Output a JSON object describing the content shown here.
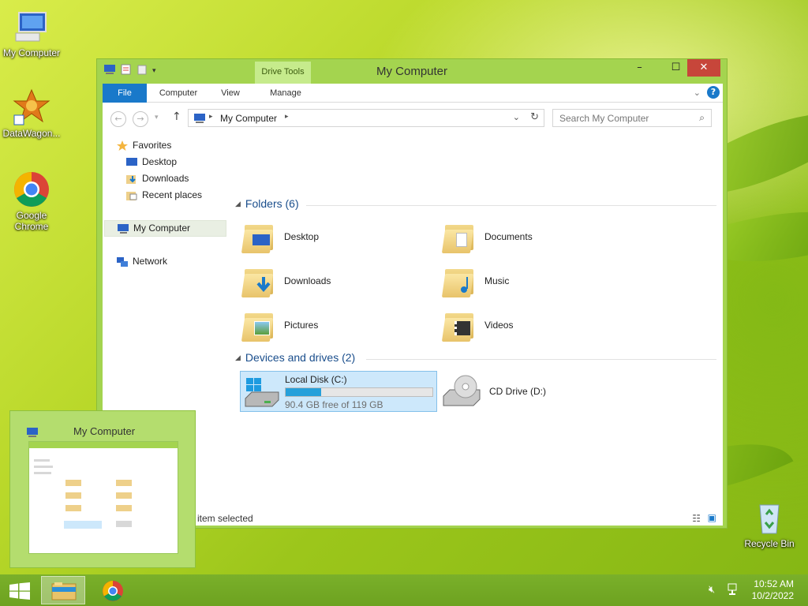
{
  "desktop": {
    "icons": [
      {
        "label": "My Computer"
      },
      {
        "label": "DataWagon..."
      },
      {
        "label": "Google Chrome"
      },
      {
        "label": "Recycle Bin"
      }
    ]
  },
  "window": {
    "title": "My Computer",
    "contextual_tab": "Drive Tools",
    "controls": {
      "minimize": "–",
      "maximize": "☐",
      "close": "✕"
    }
  },
  "ribbon": {
    "tabs": [
      {
        "label": "File"
      },
      {
        "label": "Computer"
      },
      {
        "label": "View"
      },
      {
        "label": "Manage"
      }
    ]
  },
  "address": {
    "path": "My Computer",
    "search_placeholder": "Search My Computer"
  },
  "nav_pane": {
    "favorites": "Favorites",
    "favorite_items": [
      "Desktop",
      "Downloads",
      "Recent places"
    ],
    "computer": "My Computer",
    "network": "Network"
  },
  "folders_section": {
    "title": "Folders (6)",
    "items": [
      "Desktop",
      "Documents",
      "Downloads",
      "Music",
      "Pictures",
      "Videos"
    ]
  },
  "devices_section": {
    "title": "Devices and drives (2)",
    "drives": [
      {
        "name": "Local Disk (C:)",
        "free_text": "90.4 GB free of 119 GB",
        "used_fraction": 0.24
      },
      {
        "name": "CD Drive (D:)"
      }
    ]
  },
  "status_bar": {
    "text": "1 item selected"
  },
  "thumbnail": {
    "title": "My Computer"
  },
  "taskbar": {
    "time": "10:52 AM",
    "date": "10/2/2022"
  },
  "colors": {
    "accent": "#1979ca",
    "window_frame": "#a4d44f",
    "selection": "#cde8fb",
    "disk_fill": "#26a0da"
  }
}
